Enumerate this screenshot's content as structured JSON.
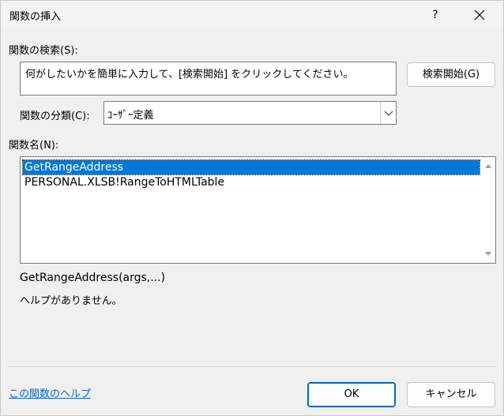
{
  "window": {
    "title": "関数の挿入",
    "help_label": "?",
    "close_label": "×"
  },
  "search": {
    "label": "関数の検索(S):",
    "value": "何がしたいかを簡単に入力して、[検索開始] をクリックしてください。",
    "button_label": "検索開始(G)"
  },
  "category": {
    "label": "関数の分類(C):",
    "selected": "ﾕｰｻﾞｰ定義"
  },
  "functions": {
    "label": "関数名(N):",
    "items": [
      "GetRangeAddress",
      "PERSONAL.XLSB!RangeToHTMLTable"
    ],
    "selected_index": 0
  },
  "description": {
    "signature": "GetRangeAddress(args,...)",
    "help_text": "ヘルプがありません。"
  },
  "footer": {
    "help_link": "この関数のヘルプ",
    "ok_label": "OK",
    "cancel_label": "キャンセル"
  }
}
